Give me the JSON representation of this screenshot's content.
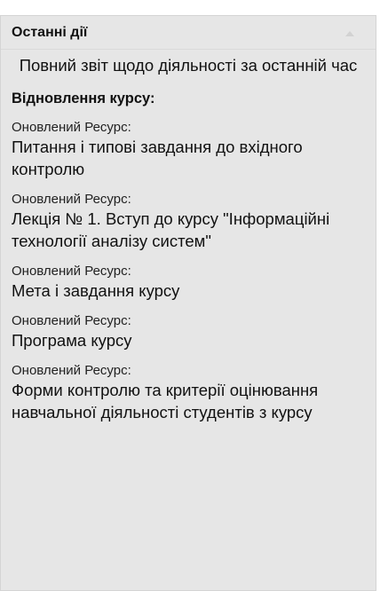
{
  "block": {
    "title": "Останні дії",
    "full_report_link": "Повний звіт щодо діяльності за останній час",
    "section_heading": "Відновлення курсу:",
    "activities": [
      {
        "label": "Оновлений Ресурс:",
        "title": "Питання і типові завдання до вхідного контролю"
      },
      {
        "label": "Оновлений Ресурс:",
        "title": "Лекція № 1. Вступ до курсу \"Інформаційні технології аналізу систем\""
      },
      {
        "label": "Оновлений Ресурс:",
        "title": "Мета і завдання курсу"
      },
      {
        "label": "Оновлений Ресурс:",
        "title": "Програма курсу"
      },
      {
        "label": "Оновлений Ресурс:",
        "title": "Форми контролю та критерії оцінювання навчальної діяльності студентів з курсу"
      }
    ]
  },
  "icons": {
    "collapse": "chevron-up-icon"
  },
  "colors": {
    "block_background": "#e6e6e6",
    "text": "#111111"
  }
}
